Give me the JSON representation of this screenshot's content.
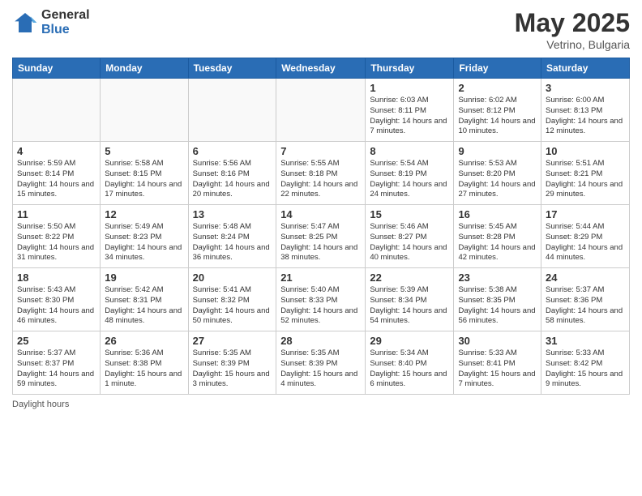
{
  "logo": {
    "general": "General",
    "blue": "Blue"
  },
  "title": {
    "month_year": "May 2025",
    "location": "Vetrino, Bulgaria"
  },
  "weekdays": [
    "Sunday",
    "Monday",
    "Tuesday",
    "Wednesday",
    "Thursday",
    "Friday",
    "Saturday"
  ],
  "weeks": [
    [
      {
        "day": "",
        "info": ""
      },
      {
        "day": "",
        "info": ""
      },
      {
        "day": "",
        "info": ""
      },
      {
        "day": "",
        "info": ""
      },
      {
        "day": "1",
        "info": "Sunrise: 6:03 AM\nSunset: 8:11 PM\nDaylight: 14 hours and 7 minutes."
      },
      {
        "day": "2",
        "info": "Sunrise: 6:02 AM\nSunset: 8:12 PM\nDaylight: 14 hours and 10 minutes."
      },
      {
        "day": "3",
        "info": "Sunrise: 6:00 AM\nSunset: 8:13 PM\nDaylight: 14 hours and 12 minutes."
      }
    ],
    [
      {
        "day": "4",
        "info": "Sunrise: 5:59 AM\nSunset: 8:14 PM\nDaylight: 14 hours and 15 minutes."
      },
      {
        "day": "5",
        "info": "Sunrise: 5:58 AM\nSunset: 8:15 PM\nDaylight: 14 hours and 17 minutes."
      },
      {
        "day": "6",
        "info": "Sunrise: 5:56 AM\nSunset: 8:16 PM\nDaylight: 14 hours and 20 minutes."
      },
      {
        "day": "7",
        "info": "Sunrise: 5:55 AM\nSunset: 8:18 PM\nDaylight: 14 hours and 22 minutes."
      },
      {
        "day": "8",
        "info": "Sunrise: 5:54 AM\nSunset: 8:19 PM\nDaylight: 14 hours and 24 minutes."
      },
      {
        "day": "9",
        "info": "Sunrise: 5:53 AM\nSunset: 8:20 PM\nDaylight: 14 hours and 27 minutes."
      },
      {
        "day": "10",
        "info": "Sunrise: 5:51 AM\nSunset: 8:21 PM\nDaylight: 14 hours and 29 minutes."
      }
    ],
    [
      {
        "day": "11",
        "info": "Sunrise: 5:50 AM\nSunset: 8:22 PM\nDaylight: 14 hours and 31 minutes."
      },
      {
        "day": "12",
        "info": "Sunrise: 5:49 AM\nSunset: 8:23 PM\nDaylight: 14 hours and 34 minutes."
      },
      {
        "day": "13",
        "info": "Sunrise: 5:48 AM\nSunset: 8:24 PM\nDaylight: 14 hours and 36 minutes."
      },
      {
        "day": "14",
        "info": "Sunrise: 5:47 AM\nSunset: 8:25 PM\nDaylight: 14 hours and 38 minutes."
      },
      {
        "day": "15",
        "info": "Sunrise: 5:46 AM\nSunset: 8:27 PM\nDaylight: 14 hours and 40 minutes."
      },
      {
        "day": "16",
        "info": "Sunrise: 5:45 AM\nSunset: 8:28 PM\nDaylight: 14 hours and 42 minutes."
      },
      {
        "day": "17",
        "info": "Sunrise: 5:44 AM\nSunset: 8:29 PM\nDaylight: 14 hours and 44 minutes."
      }
    ],
    [
      {
        "day": "18",
        "info": "Sunrise: 5:43 AM\nSunset: 8:30 PM\nDaylight: 14 hours and 46 minutes."
      },
      {
        "day": "19",
        "info": "Sunrise: 5:42 AM\nSunset: 8:31 PM\nDaylight: 14 hours and 48 minutes."
      },
      {
        "day": "20",
        "info": "Sunrise: 5:41 AM\nSunset: 8:32 PM\nDaylight: 14 hours and 50 minutes."
      },
      {
        "day": "21",
        "info": "Sunrise: 5:40 AM\nSunset: 8:33 PM\nDaylight: 14 hours and 52 minutes."
      },
      {
        "day": "22",
        "info": "Sunrise: 5:39 AM\nSunset: 8:34 PM\nDaylight: 14 hours and 54 minutes."
      },
      {
        "day": "23",
        "info": "Sunrise: 5:38 AM\nSunset: 8:35 PM\nDaylight: 14 hours and 56 minutes."
      },
      {
        "day": "24",
        "info": "Sunrise: 5:37 AM\nSunset: 8:36 PM\nDaylight: 14 hours and 58 minutes."
      }
    ],
    [
      {
        "day": "25",
        "info": "Sunrise: 5:37 AM\nSunset: 8:37 PM\nDaylight: 14 hours and 59 minutes."
      },
      {
        "day": "26",
        "info": "Sunrise: 5:36 AM\nSunset: 8:38 PM\nDaylight: 15 hours and 1 minute."
      },
      {
        "day": "27",
        "info": "Sunrise: 5:35 AM\nSunset: 8:39 PM\nDaylight: 15 hours and 3 minutes."
      },
      {
        "day": "28",
        "info": "Sunrise: 5:35 AM\nSunset: 8:39 PM\nDaylight: 15 hours and 4 minutes."
      },
      {
        "day": "29",
        "info": "Sunrise: 5:34 AM\nSunset: 8:40 PM\nDaylight: 15 hours and 6 minutes."
      },
      {
        "day": "30",
        "info": "Sunrise: 5:33 AM\nSunset: 8:41 PM\nDaylight: 15 hours and 7 minutes."
      },
      {
        "day": "31",
        "info": "Sunrise: 5:33 AM\nSunset: 8:42 PM\nDaylight: 15 hours and 9 minutes."
      }
    ]
  ],
  "footer": {
    "note": "Daylight hours"
  }
}
